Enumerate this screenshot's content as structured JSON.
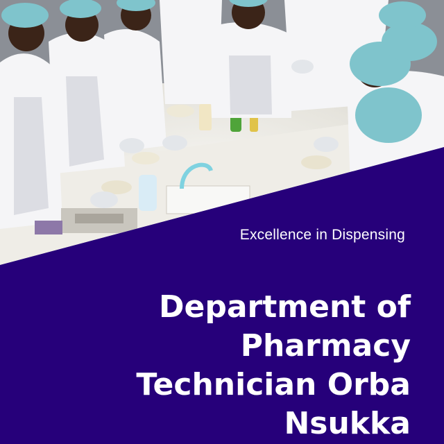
{
  "photo": {
    "icon": "lab-students-photo"
  },
  "tagline": "Excellence in Dispensing",
  "title_lines": [
    "Department of",
    "Pharmacy",
    "Technician Orba",
    "Nsukka"
  ],
  "colors": {
    "band": "#26007a",
    "text": "#ffffff",
    "hairnet": "#7fc4cc",
    "coat": "#f4f4f6"
  }
}
